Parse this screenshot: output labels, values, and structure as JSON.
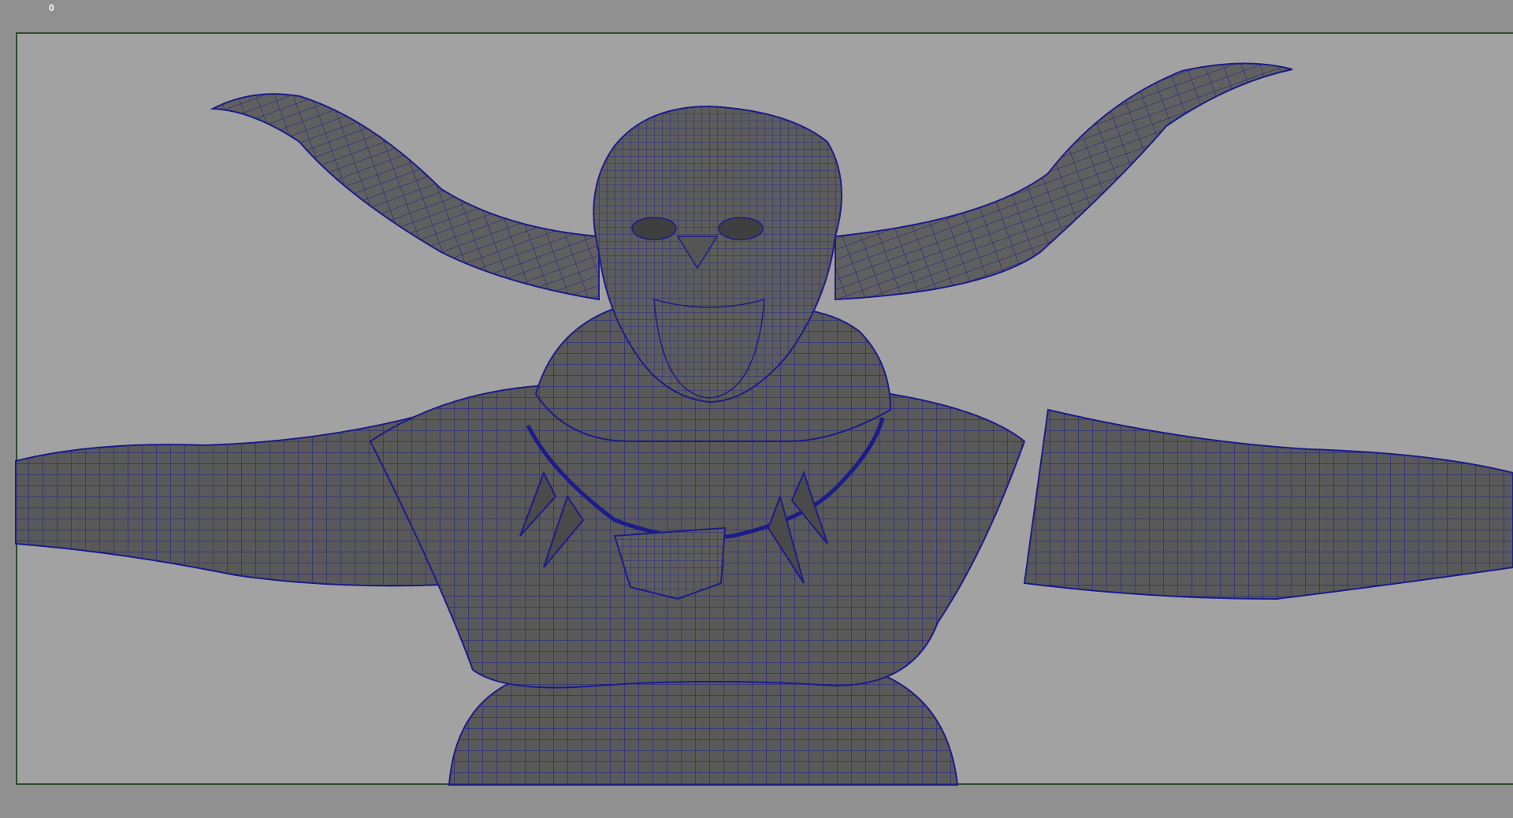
{
  "viewport": {
    "frame_label": "0",
    "colors": {
      "background": "#909090",
      "gate_fill": "#a2a2a2",
      "gate_border": "#2e4a2e",
      "mesh_fill": "#575757",
      "wireframe": "#1c1c8a"
    },
    "subject": "wireframe-character-model"
  }
}
